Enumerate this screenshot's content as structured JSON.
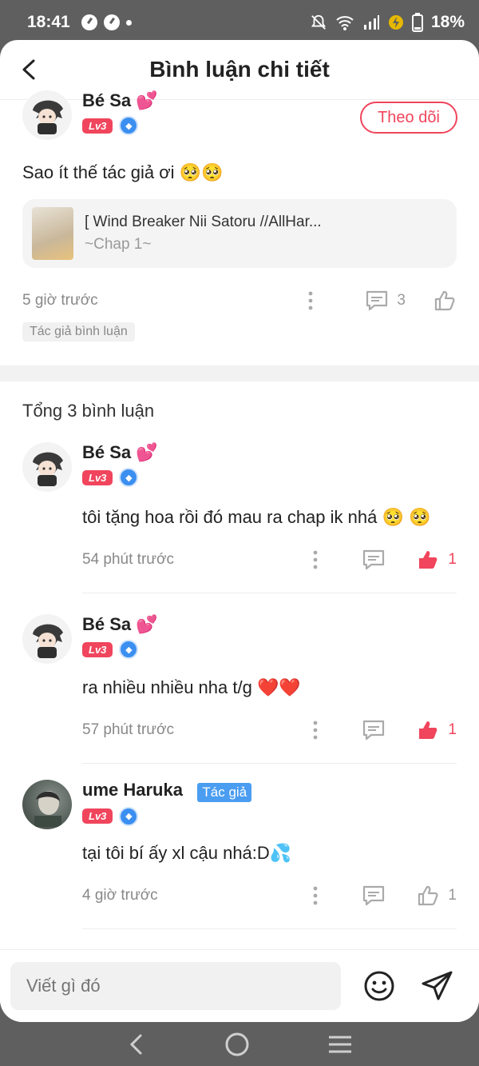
{
  "status_bar": {
    "time": "18:41",
    "battery": "18%"
  },
  "header": {
    "title": "Bình luận chi tiết"
  },
  "post": {
    "username": "Bé Sa 💕",
    "level": "Lv3",
    "follow_label": "Theo dõi",
    "content": "Sao ít thế tác giả ơi 🥺🥺",
    "story_title": "[ Wind Breaker Nii Satoru //AllHar...",
    "story_chapter": "~Chap 1~",
    "time": "5 giờ trước",
    "reply_count": "3",
    "author_tag": "Tác giả bình luận"
  },
  "total_label": "Tổng 3 bình luận",
  "comments": [
    {
      "username": "Bé Sa 💕",
      "level": "Lv3",
      "text": "tôi tặng hoa rồi đó mau ra chap ik nhá 🥺 🥺",
      "time": "54 phút trước",
      "likes": "1",
      "liked": true
    },
    {
      "username": "Bé Sa 💕",
      "level": "Lv3",
      "text": "ra nhiều nhiều nha t/g ❤️❤️",
      "time": "57 phút trước",
      "likes": "1",
      "liked": true
    },
    {
      "username": "ume Haruka",
      "author_badge": "Tác giả",
      "level": "Lv3",
      "text": "tại tôi bí ấy xl cậu nhá:D💦",
      "time": "4 giờ trước",
      "likes": "1",
      "liked": false
    }
  ],
  "input": {
    "placeholder": "Viết gì đó"
  },
  "colors": {
    "accent": "#f0455c",
    "author_badge": "#4a9df0",
    "statusbar": "#5f5f5f"
  }
}
